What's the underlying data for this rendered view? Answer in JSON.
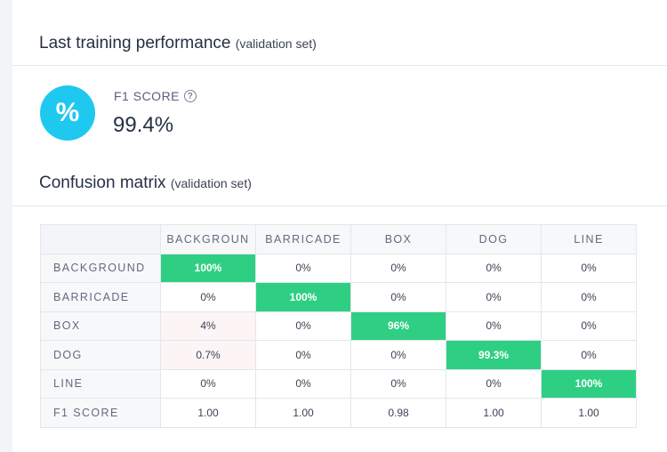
{
  "performance": {
    "title": "Last training performance",
    "subtitle": "(validation set)",
    "badge_symbol": "%",
    "badge_color": "#1fc8ef",
    "metric_label": "F1 SCORE",
    "help_icon": "question-circle-icon",
    "metric_value": "99.4%"
  },
  "confusion": {
    "title": "Confusion matrix",
    "subtitle": "(validation set)",
    "hit_color": "#2fcf83",
    "columns": [
      "BACKGROUN",
      "BARRICADE",
      "BOX",
      "DOG",
      "LINE"
    ],
    "rows": [
      {
        "label": "BACKGROUND",
        "cells": [
          "100%",
          "0%",
          "0%",
          "0%",
          "0%"
        ]
      },
      {
        "label": "BARRICADE",
        "cells": [
          "0%",
          "100%",
          "0%",
          "0%",
          "0%"
        ]
      },
      {
        "label": "BOX",
        "cells": [
          "4%",
          "0%",
          "96%",
          "0%",
          "0%"
        ]
      },
      {
        "label": "DOG",
        "cells": [
          "0.7%",
          "0%",
          "0%",
          "99.3%",
          "0%"
        ]
      },
      {
        "label": "LINE",
        "cells": [
          "0%",
          "0%",
          "0%",
          "0%",
          "100%"
        ]
      },
      {
        "label": "F1 SCORE",
        "cells": [
          "1.00",
          "1.00",
          "0.98",
          "1.00",
          "1.00"
        ]
      }
    ]
  }
}
